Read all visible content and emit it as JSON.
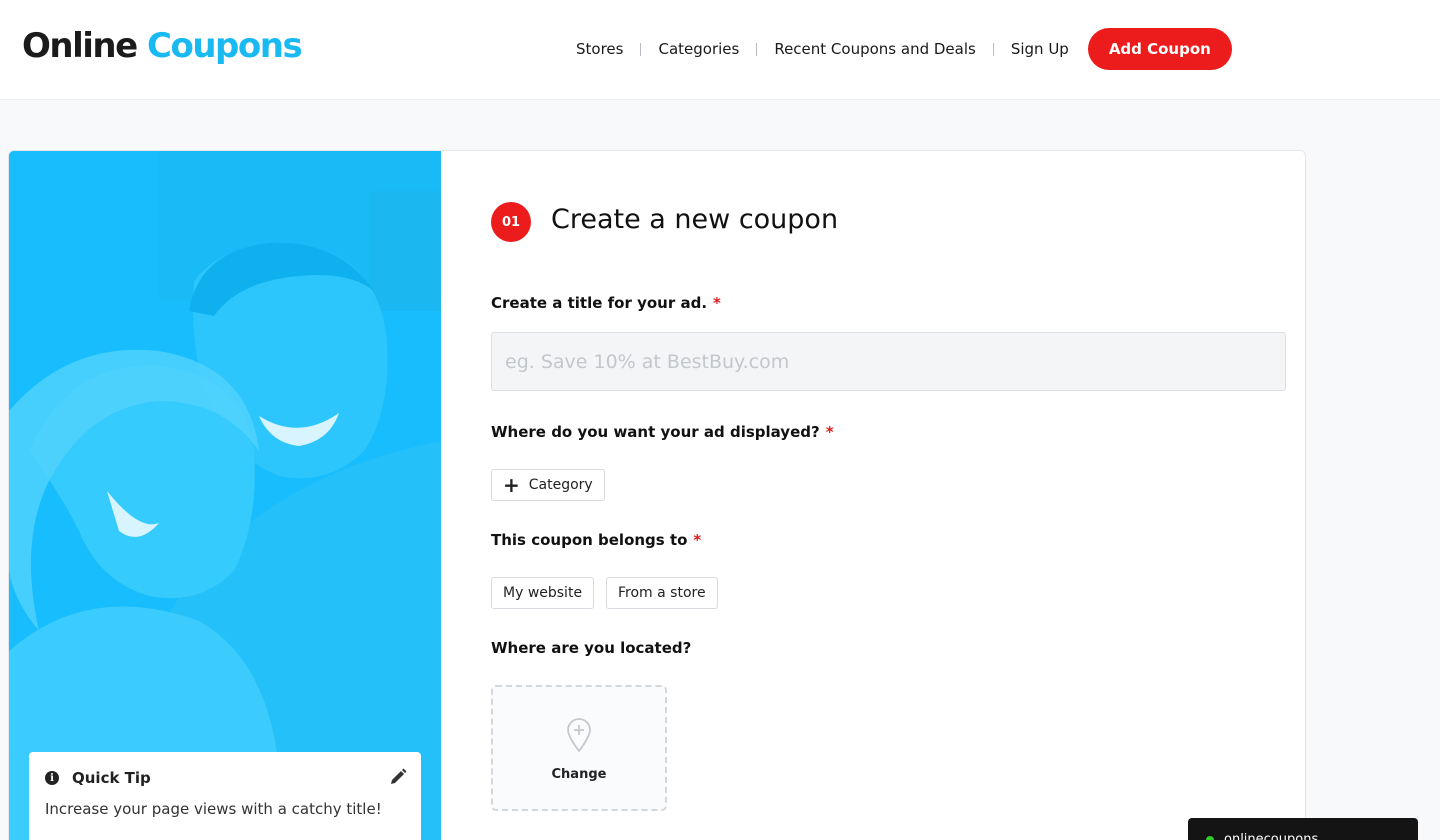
{
  "header": {
    "logo_part1": "Online",
    "logo_part2": "Coupons",
    "nav": [
      "Stores",
      "Categories",
      "Recent Coupons and Deals",
      "Sign Up"
    ],
    "add_coupon": "Add Coupon"
  },
  "sidebar": {
    "tip_title": "Quick Tip",
    "tip_text": "Increase your page views with a catchy title!"
  },
  "form": {
    "step": "01",
    "title": "Create a new coupon",
    "title_label": "Create a title for your ad.",
    "title_placeholder": "eg. Save 10% at BestBuy.com",
    "display_label": "Where do you want your ad displayed?",
    "category_button": "Category",
    "belongs_label": "This coupon belongs to",
    "belongs_options": [
      "My website",
      "From a store"
    ],
    "location_label": "Where are you located?",
    "location_button": "Change",
    "required_mark": "*"
  },
  "toast": {
    "text": "onlinecoupons"
  },
  "colors": {
    "brand_blue": "#19b9f2",
    "accent_red": "#ec1c1c",
    "sidebar_blue": "#17bdfc"
  }
}
